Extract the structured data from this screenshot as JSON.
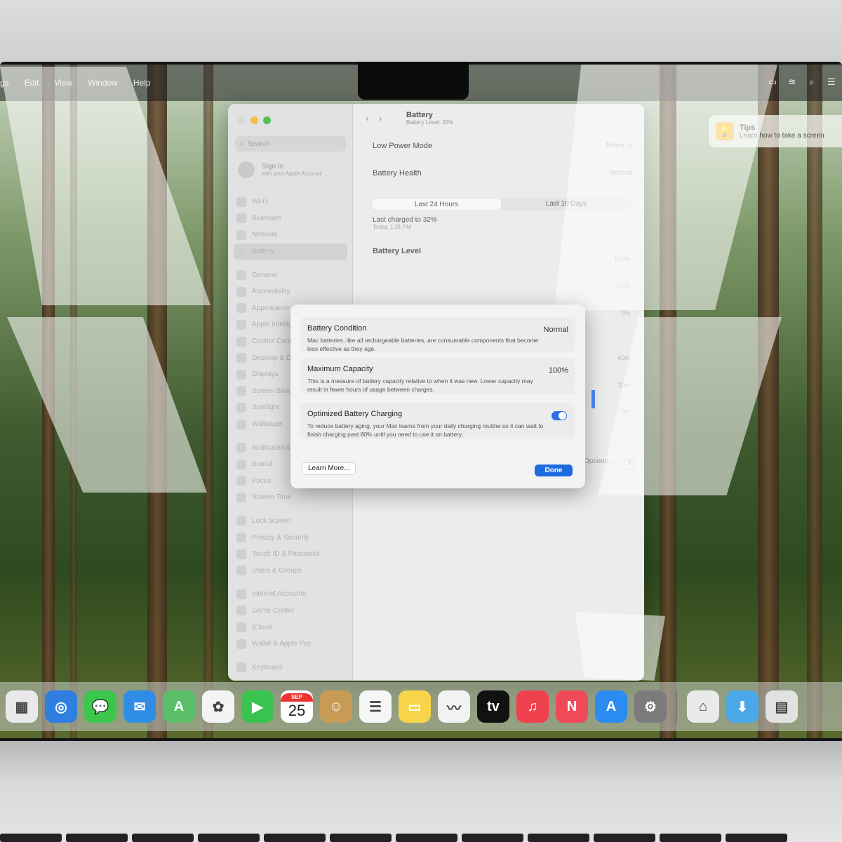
{
  "menubar": {
    "items": [
      "gs",
      "Edit",
      "View",
      "Window",
      "Help"
    ],
    "status_icons": [
      "battery-icon",
      "wifi-icon",
      "search-icon",
      "control-center-icon"
    ]
  },
  "tips": {
    "title": "Tips",
    "text": "Learn how to take a screen"
  },
  "window": {
    "title": "Battery",
    "subtitle": "Battery Level: 32%",
    "search_placeholder": "Search",
    "signin": {
      "title": "Sign In",
      "subtitle": "with your Apple Account"
    },
    "sidebar": [
      {
        "label": "Wi-Fi"
      },
      {
        "label": "Bluetooth"
      },
      {
        "label": "Network"
      },
      {
        "label": "Battery",
        "selected": true
      },
      {
        "gap": true
      },
      {
        "label": "General"
      },
      {
        "label": "Accessibility"
      },
      {
        "label": "Appearance"
      },
      {
        "label": "Apple Intelligence"
      },
      {
        "label": "Control Centre"
      },
      {
        "label": "Desktop & Dock"
      },
      {
        "label": "Displays"
      },
      {
        "label": "Screen Saver"
      },
      {
        "label": "Spotlight"
      },
      {
        "label": "Wallpaper"
      },
      {
        "gap": true
      },
      {
        "label": "Notifications"
      },
      {
        "label": "Sound"
      },
      {
        "label": "Focus"
      },
      {
        "label": "Screen Time"
      },
      {
        "gap": true
      },
      {
        "label": "Lock Screen"
      },
      {
        "label": "Privacy & Security"
      },
      {
        "label": "Touch ID & Password"
      },
      {
        "label": "Users & Groups"
      },
      {
        "gap": true
      },
      {
        "label": "Internet Accounts"
      },
      {
        "label": "Game Center"
      },
      {
        "label": "iCloud"
      },
      {
        "label": "Wallet & Apple Pay"
      },
      {
        "gap": true
      },
      {
        "label": "Keyboard"
      }
    ],
    "low_power": {
      "label": "Low Power Mode",
      "value": "Never ◇"
    },
    "health": {
      "label": "Battery Health",
      "value": "Normal"
    },
    "tabs": [
      "Last 24 Hours",
      "Last 10 Days"
    ],
    "last_charged": {
      "title": "Last charged to 32%",
      "time": "Today, 1:31 PM"
    },
    "battery_level_label": "Battery Level",
    "axis_top": [
      "100%",
      "50%",
      "0%"
    ],
    "axis_bottom": [
      "60m",
      "30m",
      "0m"
    ],
    "options_label": "Options...",
    "help_label": "?"
  },
  "sheet": {
    "condition": {
      "title": "Battery Condition",
      "value": "Normal",
      "desc": "Mac batteries, like all rechargeable batteries, are consumable components that become less effective as they age."
    },
    "capacity": {
      "title": "Maximum Capacity",
      "value": "100%",
      "desc": "This is a measure of battery capacity relative to when it was new. Lower capacity may result in fewer hours of usage between charges."
    },
    "optimized": {
      "title": "Optimized Battery Charging",
      "enabled": true,
      "desc": "To reduce battery aging, your Mac learns from your daily charging routine so it can wait to finish charging past 80% until you need to use it on battery."
    },
    "learn_more": "Learn More...",
    "done": "Done"
  },
  "dock": {
    "calendar": {
      "month": "SEP",
      "day": "25"
    },
    "apps": [
      {
        "name": "launchpad-icon",
        "color": "#e9e9e9",
        "glyph": "▦"
      },
      {
        "name": "safari-icon",
        "color": "#2f7fe0",
        "glyph": "◎"
      },
      {
        "name": "messages-icon",
        "color": "#3cc64b",
        "glyph": "💬"
      },
      {
        "name": "mail-icon",
        "color": "#2f8de6",
        "glyph": "✉"
      },
      {
        "name": "maps-icon",
        "color": "#5bbf6a",
        "glyph": "A"
      },
      {
        "name": "photos-icon",
        "color": "#f4f4f4",
        "glyph": "✿"
      },
      {
        "name": "facetime-icon",
        "color": "#39c450",
        "glyph": "▶"
      },
      {
        "name": "calendar-icon",
        "color": "#ffffff",
        "glyph": ""
      },
      {
        "name": "contacts-icon",
        "color": "#c79a55",
        "glyph": "☺"
      },
      {
        "name": "reminders-icon",
        "color": "#f6f6f6",
        "glyph": "☰"
      },
      {
        "name": "notes-icon",
        "color": "#f7d54a",
        "glyph": "▭"
      },
      {
        "name": "freeform-icon",
        "color": "#f2f2f2",
        "glyph": "〰"
      },
      {
        "name": "apple-tv-icon",
        "color": "#111111",
        "glyph": "tv"
      },
      {
        "name": "music-icon",
        "color": "#f0414f",
        "glyph": "♫"
      },
      {
        "name": "news-icon",
        "color": "#f04a59",
        "glyph": "N"
      },
      {
        "name": "app-store-icon",
        "color": "#2a8cf0",
        "glyph": "A"
      },
      {
        "name": "system-settings-icon",
        "color": "#7b7b7b",
        "glyph": "⚙"
      }
    ],
    "right": [
      {
        "name": "iphone-mirroring-icon",
        "color": "#eaeaea",
        "glyph": "⌂"
      },
      {
        "name": "downloads-folder-icon",
        "color": "#4aa7e8",
        "glyph": "⬇"
      },
      {
        "name": "finder-window-icon",
        "color": "#e2e2e2",
        "glyph": "▤"
      }
    ]
  }
}
